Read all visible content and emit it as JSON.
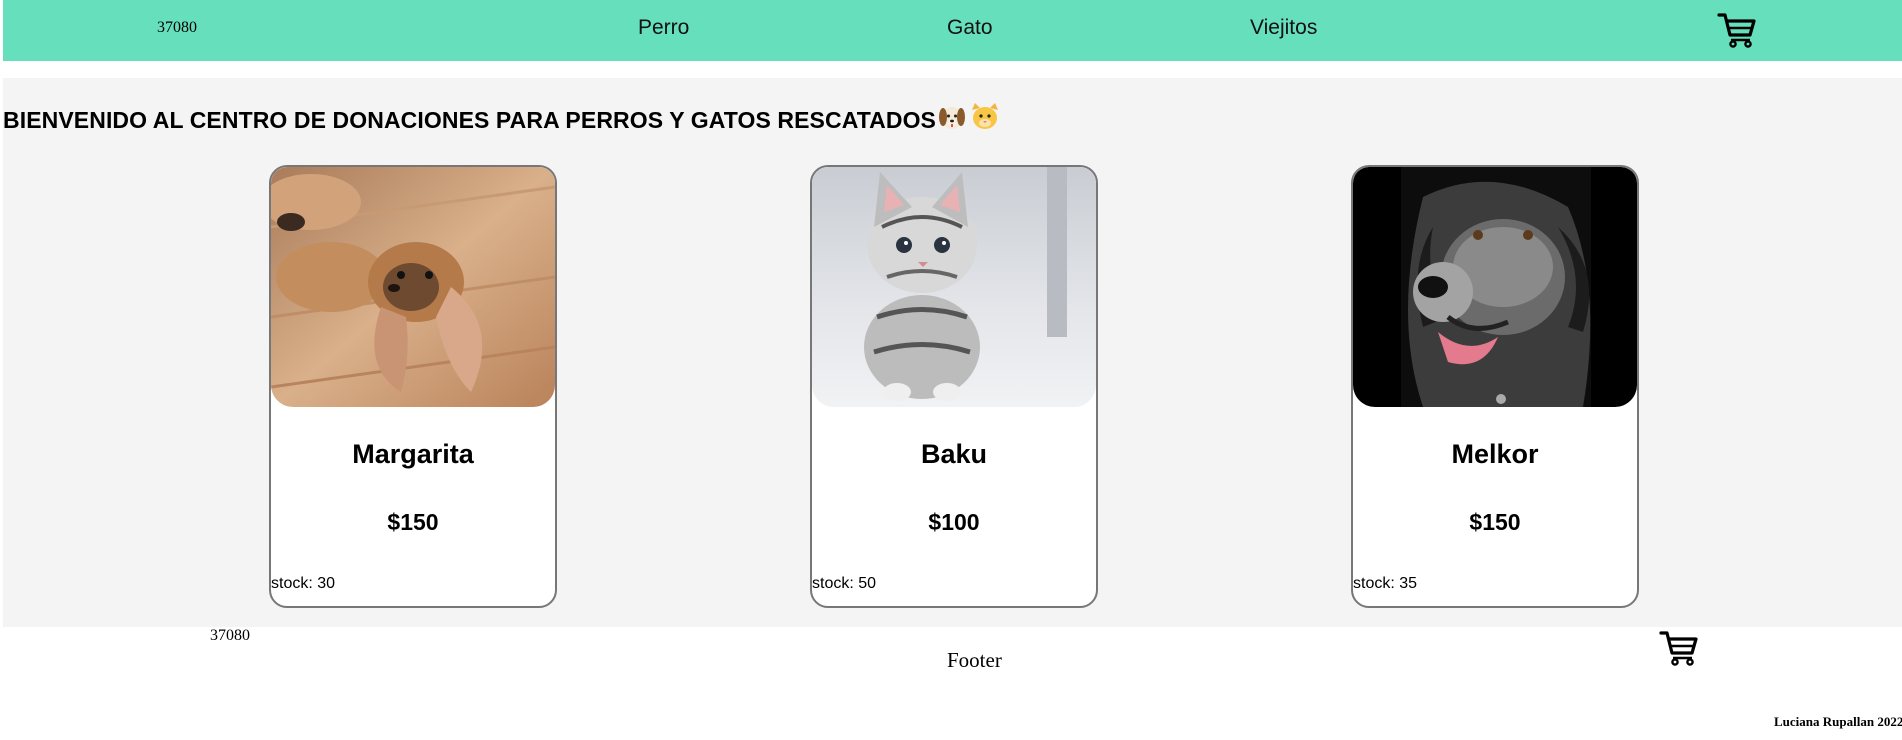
{
  "header": {
    "logo": "37080",
    "nav": [
      {
        "label": "Perro"
      },
      {
        "label": "Gato"
      },
      {
        "label": "Viejitos"
      }
    ],
    "cart_icon": "shopping-cart-icon"
  },
  "main": {
    "welcome": "BIENVENIDO AL CENTRO DE DONACIONES PARA PERROS Y GATOS RESCATADOS",
    "welcome_emojis": "🐶🐱",
    "products": [
      {
        "name": "Margarita",
        "price": "$150",
        "stock": "stock: 30",
        "image": "puppy-photo"
      },
      {
        "name": "Baku",
        "price": "$100",
        "stock": "stock: 50",
        "image": "kitten-photo"
      },
      {
        "name": "Melkor",
        "price": "$150",
        "stock": "stock: 35",
        "image": "old-dog-photo"
      }
    ]
  },
  "footer": {
    "logo": "37080",
    "title": "Footer",
    "credit": "Luciana Rupallan 2022",
    "cart_icon": "shopping-cart-icon"
  },
  "colors": {
    "navbar": "#66e0bc",
    "main_bg": "#f4f4f4",
    "card_border": "#777777"
  }
}
